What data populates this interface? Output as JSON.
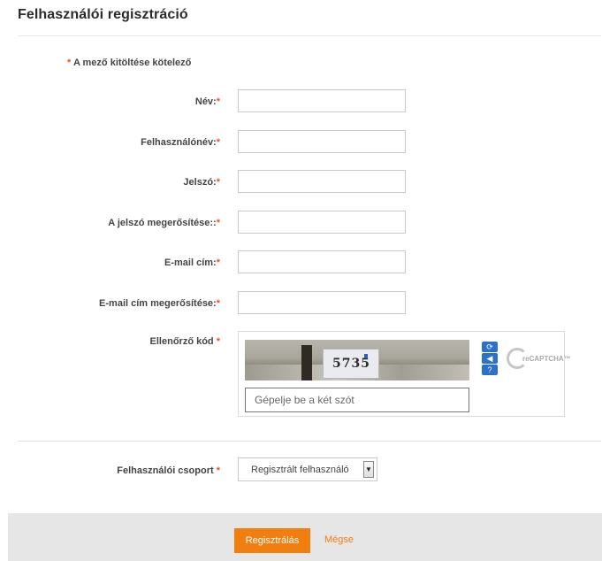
{
  "page": {
    "title": "Felhasználói regisztráció"
  },
  "form": {
    "required_star": "*",
    "required_note": "A mező kitöltése kötelező",
    "fields": [
      {
        "label": "Név:",
        "value": ""
      },
      {
        "label": "Felhasználónév:",
        "value": ""
      },
      {
        "label": "Jelszó:",
        "value": ""
      },
      {
        "label": "A jelszó megerősítése::",
        "value": ""
      },
      {
        "label": "E-mail cím:",
        "value": ""
      },
      {
        "label": "E-mail cím megerősítése:",
        "value": ""
      }
    ],
    "captcha": {
      "label": "Ellenőrző kód",
      "image_text": "5735",
      "input_placeholder": "Gépelje be a két szót",
      "logo_text": "reCAPTCHA™",
      "icons": [
        "refresh-icon",
        "audio-icon",
        "help-icon"
      ]
    },
    "group": {
      "label": "Felhasználói csoport",
      "selected": "Regisztrált felhasználó"
    }
  },
  "actions": {
    "register_label": "Regisztrálás",
    "cancel_label": "Mégse"
  },
  "colors": {
    "accent": "#f07f0f",
    "star": "#e4572e",
    "footer_bg": "#e6e6e6"
  }
}
